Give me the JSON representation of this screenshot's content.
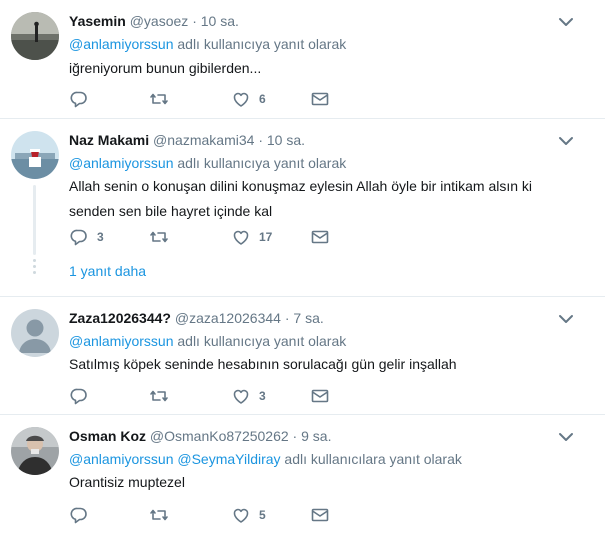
{
  "colors": {
    "link": "#1b95e0",
    "muted": "#657786",
    "text": "#14171a",
    "border": "#e6ecf0"
  },
  "tweets": [
    {
      "name": "Yasemin",
      "handle": "@yasoez",
      "time": "10 sa.",
      "reply_prefix": "@anlamiyorssun",
      "reply_suffix": " adlı kullanıcıya yanıt olarak",
      "text": "iğreniyorum bunun gibilerden...",
      "replies": "",
      "retweets": "",
      "likes": "6"
    },
    {
      "name": "Naz Makami",
      "handle": "@nazmakami34",
      "time": "10 sa.",
      "reply_prefix": "@anlamiyorssun",
      "reply_suffix": " adlı kullanıcıya yanıt olarak",
      "text": "Allah senin o konuşan dilini konuşmaz eylesin Allah öyle bir intikam alsın ki senden sen bile hayret içinde kal",
      "replies": "3",
      "retweets": "",
      "likes": "17",
      "more_replies": "1 yanıt daha"
    },
    {
      "name": "Zaza12026344?",
      "handle": "@zaza12026344",
      "time": "7 sa.",
      "reply_prefix": "@anlamiyorssun",
      "reply_suffix": " adlı kullanıcıya yanıt olarak",
      "text": "Satılmış köpek seninde hesabının sorulacağı gün gelir inşallah",
      "replies": "",
      "retweets": "",
      "likes": "3"
    },
    {
      "name": "Osman Koz",
      "handle": "@OsmanKo87250262",
      "time": "9 sa.",
      "reply_prefix": "@anlamiyorssun",
      "reply_prefix2": "@SeymaYildiray",
      "reply_suffix": " adlı kullanıcılara yanıt olarak",
      "text": "Orantisiz muptezel",
      "replies": "",
      "retweets": "",
      "likes": "5"
    }
  ]
}
